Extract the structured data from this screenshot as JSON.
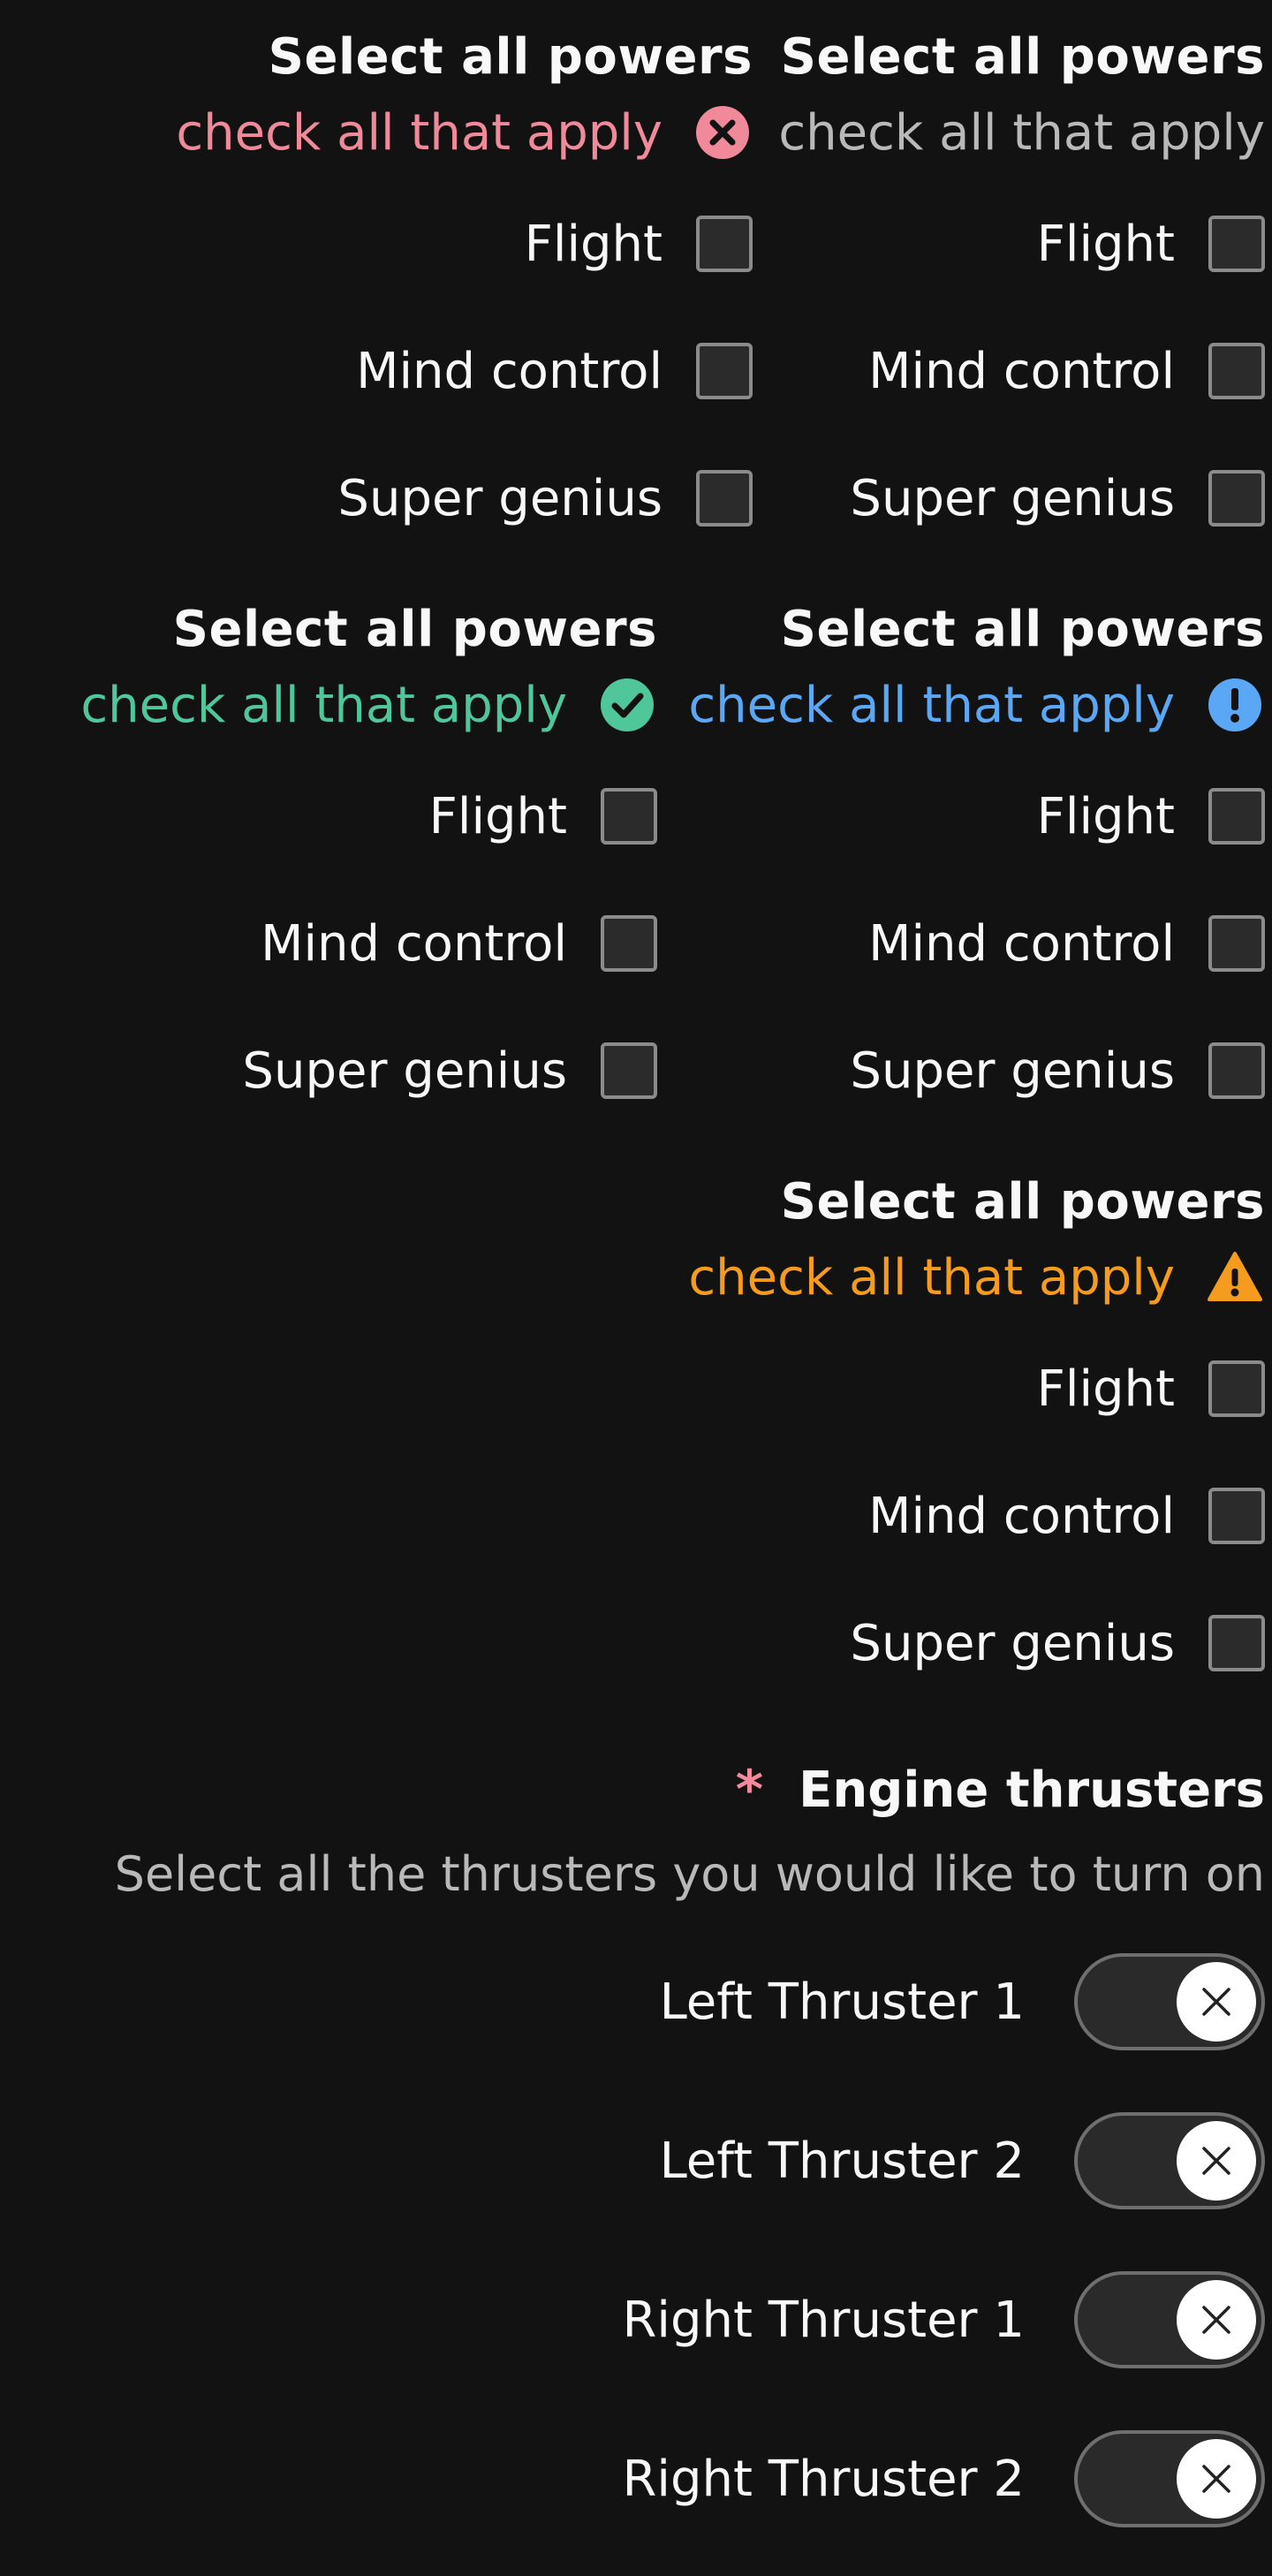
{
  "groups": [
    {
      "title": "Select all powers",
      "hint": "check all that apply",
      "status": "error",
      "status_icon": "error-circle-icon",
      "hint_color": "#f08a9a",
      "icon_color": "#f08a9a",
      "options": [
        "Flight",
        "Mind control",
        "Super genius"
      ]
    },
    {
      "title": "Select all powers",
      "hint": "check all that apply",
      "status": "default",
      "hint_color": "#b9b9b9",
      "options": [
        "Flight",
        "Mind control",
        "Super genius"
      ]
    },
    {
      "title": "Select all powers",
      "hint": "check all that apply",
      "status": "success",
      "status_icon": "check-circle-icon",
      "hint_color": "#4fc79a",
      "icon_color": "#4fc79a",
      "options": [
        "Flight",
        "Mind control",
        "Super genius"
      ]
    },
    {
      "title": "Select all powers",
      "hint": "check all that apply",
      "status": "info",
      "status_icon": "info-circle-icon",
      "hint_color": "#5aa8f5",
      "icon_color": "#5aa8f5",
      "options": [
        "Flight",
        "Mind control",
        "Super genius"
      ]
    },
    {
      "title": "Select all powers",
      "hint": "check all that apply",
      "status": "warning",
      "status_icon": "warning-triangle-icon",
      "hint_color": "#f59c1e",
      "icon_color": "#f59c1e",
      "options": [
        "Flight",
        "Mind control",
        "Super genius"
      ]
    }
  ],
  "engine": {
    "required_marker": "*",
    "title": "Engine thrusters",
    "description": "Select all the thrusters you would like to turn on",
    "toggles": [
      {
        "label": "Left Thruster 1",
        "checked": false,
        "knob_icon": "x-icon"
      },
      {
        "label": "Left Thruster 2",
        "checked": false,
        "knob_icon": "x-icon"
      },
      {
        "label": "Right Thruster 1",
        "checked": false,
        "knob_icon": "x-icon"
      },
      {
        "label": "Right Thruster 2",
        "checked": false,
        "knob_icon": "x-icon"
      }
    ]
  }
}
